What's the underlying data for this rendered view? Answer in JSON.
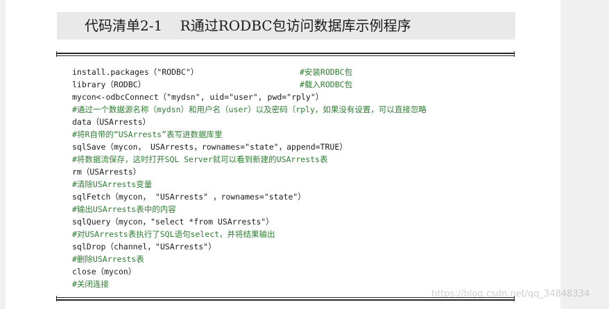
{
  "title": {
    "label": "代码清单2-1",
    "text": "R通过RODBC包访问数据库示例程序"
  },
  "code_lines": [
    {
      "type": "code",
      "code": "install.packages（\"RODBC\"）",
      "comment": "#安装RODBC包"
    },
    {
      "type": "code",
      "code": "library（RODBC）",
      "comment": "#载入RODBC包"
    },
    {
      "type": "code",
      "code": "mycon<-odbcConnect（\"mydsn\", uid=\"user\", pwd=\"rply\"）",
      "comment": ""
    },
    {
      "type": "comment",
      "code": "",
      "comment": "#通过一个数据源名称（mydsn）和用户名（user）以及密码（rply，如果没有设置，可以直接忽略"
    },
    {
      "type": "code",
      "code": "data（USArrests）",
      "comment": ""
    },
    {
      "type": "comment",
      "code": "",
      "comment": "#将R自带的“USArrests”表写进数据库里"
    },
    {
      "type": "code",
      "code": "sqlSave（mycon， USArrests，rownames=\"state\"，append=TRUE）",
      "comment": ""
    },
    {
      "type": "comment",
      "code": "",
      "comment": "#将数据流保存，这时打开SQL Server就可以看到新建的USArrests表"
    },
    {
      "type": "code",
      "code": "rm（USArrests）",
      "comment": ""
    },
    {
      "type": "comment",
      "code": "",
      "comment": "#清除USArrests变量"
    },
    {
      "type": "code",
      "code": "sqlFetch（mycon， \"USArrests\" ，rownames=\"state\"）",
      "comment": ""
    },
    {
      "type": "comment",
      "code": "",
      "comment": "#输出USArrests表中的内容"
    },
    {
      "type": "code",
      "code": "sqlQuery（mycon，\"select *from USArrests\"）",
      "comment": ""
    },
    {
      "type": "comment",
      "code": "",
      "comment": "#对USArrests表执行了SQL语句select，并将结果输出"
    },
    {
      "type": "code",
      "code": "sqlDrop（channel，\"USArrests\"）",
      "comment": ""
    },
    {
      "type": "comment",
      "code": "",
      "comment": "#删除USArrests表"
    },
    {
      "type": "code",
      "code": "close（mycon）",
      "comment": ""
    },
    {
      "type": "comment",
      "code": "",
      "comment": "#关闭连接"
    }
  ],
  "watermark": "https://blog.csdn.net/qq_34848334"
}
